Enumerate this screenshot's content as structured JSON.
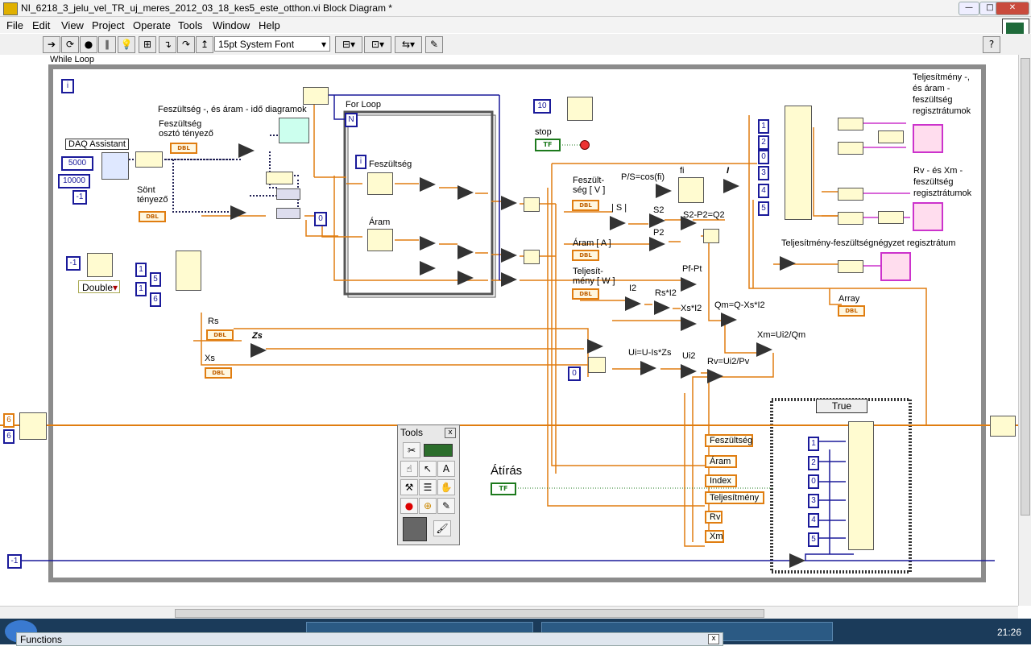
{
  "window": {
    "title": "NI_6218_3_jelu_vel_TR_uj_meres_2012_03_18_kes5_este_otthon.vi Block Diagram *",
    "min_label": "—",
    "max_label": "□",
    "close_label": "✕"
  },
  "menu": [
    "File",
    "Edit",
    "View",
    "Project",
    "Operate",
    "Tools",
    "Window",
    "Help"
  ],
  "toolbar": {
    "font": "15pt System Font",
    "help": "?"
  },
  "diagram": {
    "while_loop_label": "While Loop",
    "for_loop_label": "For Loop",
    "iteration_i": "i",
    "count_n": "N",
    "labels": {
      "fesz_aram_ido": "Feszültség -, és áram - idő diagramok",
      "fesz_oszto": "Feszültség\nosztó tényező",
      "daq": "DAQ Assistant",
      "sont": "Sönt\ntényező",
      "fesz_loop": "Feszültség",
      "aram_loop": "Áram",
      "stop": "stop",
      "ps": "P/S=cos(fi)",
      "fi": "fi",
      "I": "I",
      "s": "| S |",
      "s2": "S2",
      "s2p2": "S2-P2=Q2",
      "p2": "P2",
      "pfpt": "Pf-Pt",
      "i2": "I2",
      "rsi2": "Rs*I2",
      "xsi2": "Xs*I2",
      "qm": "Qm=Q-Xs*I2",
      "xm": "Xm=Ui2/Qm",
      "ui": "Ui=U-Is*Zs",
      "ui2": "Ui2",
      "rv": "Rv=Ui2/Pv",
      "zs": "Zs",
      "rs": "Rs",
      "xs": "Xs",
      "fesz_v": "Feszült-\nség [ V ]",
      "aram_a": "Áram [ A ]",
      "telj_w": "Teljesít-\nmény [ W ]",
      "reg1": "Teljesítmény -,\nés áram -\nfeszültség\nregisztrátumok",
      "reg2": "Rv - és Xm -\nfeszültség\nregisztrátumok",
      "reg3": "Teljesítmény-feszültségnégyzet regisztrátum",
      "array": "Array",
      "atiras": "Átírás",
      "case_sel": "True"
    },
    "constants": {
      "c5000": "5000",
      "c10000": "10000",
      "cm1a": "-1",
      "c0": "0",
      "c10": "10",
      "cm1b": "-1",
      "c1": "1",
      "c5": "5",
      "c1b": "1",
      "c6": "6",
      "c0b": "0",
      "cm1c": "-1",
      "idx": [
        "1",
        "2",
        "0",
        "3",
        "4",
        "5"
      ],
      "caseidx": [
        "1",
        "2",
        "0",
        "3",
        "4",
        "5"
      ],
      "sr6a": "6",
      "sr6b": "6"
    },
    "double_dropdown": "Double",
    "dbl": "DBL",
    "tf": "TF",
    "case_inputs": [
      "Feszültség",
      "Áram",
      "Index",
      "Teljesítmény",
      "Rv",
      "Xm"
    ]
  },
  "tools_palette": {
    "title": "Tools",
    "close": "x"
  },
  "functions_palette": {
    "title": "Functions",
    "close": "x"
  },
  "clock": "21:26"
}
